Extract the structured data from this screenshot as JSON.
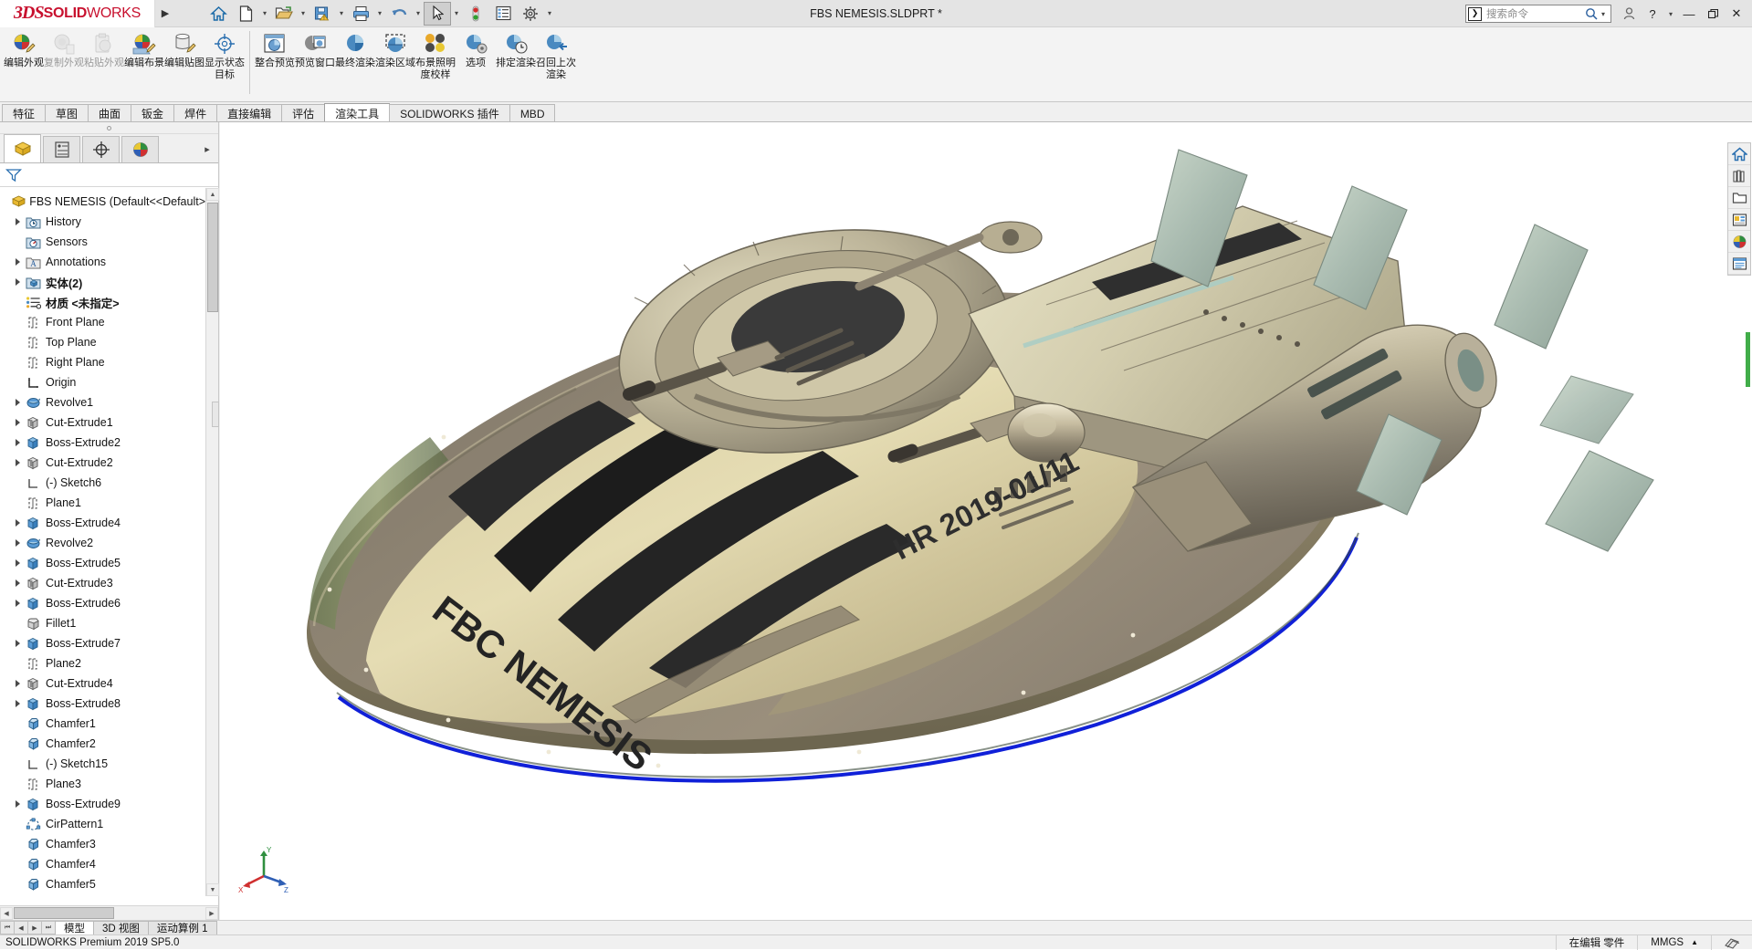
{
  "app": {
    "brand_ds": "3DS",
    "brand_solid": "SOLID",
    "brand_works": "WORKS",
    "title": "FBS NEMESIS.SLDPRT *",
    "accent_red": "#c8102e",
    "accent_blue": "#1e6fbf"
  },
  "titlebar": {
    "quick_access": [
      {
        "name": "home-icon",
        "label": "主页"
      },
      {
        "name": "new-document-icon",
        "label": "新建"
      },
      {
        "name": "open-document-icon",
        "label": "打开"
      },
      {
        "name": "save-icon",
        "label": "保存"
      },
      {
        "name": "print-icon",
        "label": "打印"
      },
      {
        "name": "undo-icon",
        "label": "撤销"
      },
      {
        "name": "select-cursor-icon",
        "label": "选择"
      },
      {
        "name": "rebuild-icon",
        "label": "重建模型"
      },
      {
        "name": "options-list-icon",
        "label": "文件属性"
      },
      {
        "name": "settings-gear-icon",
        "label": "选项"
      }
    ],
    "search_placeholder": "搜索命令",
    "search_value": "",
    "window_buttons": [
      {
        "name": "user-account-icon",
        "glyph": "○"
      },
      {
        "name": "help-icon",
        "glyph": "?"
      },
      {
        "name": "help-dropdown-icon",
        "glyph": "▾"
      },
      {
        "name": "minimize-button",
        "glyph": "—"
      },
      {
        "name": "restore-button",
        "glyph": "❐"
      },
      {
        "name": "close-button",
        "glyph": "✕"
      }
    ]
  },
  "ribbon": {
    "groups": [
      {
        "items": [
          {
            "name": "edit-appearance-button",
            "label": "编辑外观",
            "icon": "appearance-ball-pencil",
            "disabled": false
          },
          {
            "name": "copy-appearance-button",
            "label": "复制外观",
            "icon": "appearance-ball-copy",
            "disabled": true
          },
          {
            "name": "paste-appearance-button",
            "label": "粘贴外观",
            "icon": "appearance-ball-paste",
            "disabled": true
          },
          {
            "name": "edit-scene-button",
            "label": "编辑布景",
            "icon": "scene-pencil",
            "disabled": false
          },
          {
            "name": "edit-decal-button",
            "label": "编辑贴图",
            "icon": "decal-pencil",
            "disabled": false
          },
          {
            "name": "display-state-target-button",
            "label": "显示状态目标",
            "icon": "target-crosshair",
            "disabled": false
          }
        ]
      },
      {
        "items": [
          {
            "name": "integrated-preview-button",
            "label": "整合预览",
            "icon": "preview-window",
            "disabled": false
          },
          {
            "name": "preview-window-button",
            "label": "预览窗口",
            "icon": "preview-pane",
            "disabled": false
          },
          {
            "name": "final-render-button",
            "label": "最终渲染",
            "icon": "render-ball",
            "disabled": false
          },
          {
            "name": "render-region-button",
            "label": "渲染区域",
            "icon": "render-region",
            "disabled": false
          },
          {
            "name": "scene-illumination-proof-button",
            "label": "布景照明度校样",
            "icon": "illumination-proof",
            "disabled": false
          },
          {
            "name": "options-button",
            "label": "选项",
            "icon": "options-ball-gear",
            "disabled": false
          },
          {
            "name": "schedule-render-button",
            "label": "排定渲染",
            "icon": "schedule-clock",
            "disabled": false
          },
          {
            "name": "recall-last-render-button",
            "label": "召回上次渲染",
            "icon": "recall-render",
            "disabled": false
          }
        ]
      }
    ]
  },
  "command_tabs": {
    "items": [
      {
        "name": "tab-features",
        "label": "特征",
        "active": false
      },
      {
        "name": "tab-sketch",
        "label": "草图",
        "active": false
      },
      {
        "name": "tab-surfaces",
        "label": "曲面",
        "active": false
      },
      {
        "name": "tab-sheetmetal",
        "label": "钣金",
        "active": false
      },
      {
        "name": "tab-weldments",
        "label": "焊件",
        "active": false
      },
      {
        "name": "tab-direct-editing",
        "label": "直接编辑",
        "active": false
      },
      {
        "name": "tab-evaluate",
        "label": "评估",
        "active": false
      },
      {
        "name": "tab-render-tools",
        "label": "渲染工具",
        "active": true
      },
      {
        "name": "tab-solidworks-addins",
        "label": "SOLIDWORKS 插件",
        "active": false
      },
      {
        "name": "tab-mbd",
        "label": "MBD",
        "active": false
      }
    ]
  },
  "feature_manager": {
    "panel_tabs": [
      {
        "name": "feature-manager-tab",
        "icon": "yellow-block-icon",
        "active": true
      },
      {
        "name": "property-manager-tab",
        "icon": "property-page-icon",
        "active": false
      },
      {
        "name": "configuration-manager-tab",
        "icon": "config-target-icon",
        "active": false
      },
      {
        "name": "display-manager-tab",
        "icon": "appearance-ball-icon",
        "active": false
      }
    ],
    "filter_placeholder": "",
    "filter_icon": "funnel-filter-icon",
    "expand_arrow": "chevron-right-icon",
    "root": {
      "name": "feature-tree-root",
      "label": "FBS NEMESIS  (Default<<Default>",
      "icon": "part-icon"
    },
    "items": [
      {
        "label": "History",
        "icon": "history-icon",
        "expand": true,
        "indent": 1,
        "bold": false
      },
      {
        "label": "Sensors",
        "icon": "sensors-icon",
        "expand": false,
        "indent": 1,
        "bold": false
      },
      {
        "label": "Annotations",
        "icon": "annotations-icon",
        "expand": true,
        "indent": 1,
        "bold": false
      },
      {
        "label": "实体(2)",
        "icon": "solid-bodies-icon",
        "expand": true,
        "indent": 1,
        "bold": true
      },
      {
        "label": "材质 <未指定>",
        "icon": "material-icon",
        "expand": false,
        "indent": 1,
        "bold": true
      },
      {
        "label": "Front Plane",
        "icon": "plane-icon",
        "expand": false,
        "indent": 1,
        "bold": false
      },
      {
        "label": "Top Plane",
        "icon": "plane-icon",
        "expand": false,
        "indent": 1,
        "bold": false
      },
      {
        "label": "Right Plane",
        "icon": "plane-icon",
        "expand": false,
        "indent": 1,
        "bold": false
      },
      {
        "label": "Origin",
        "icon": "origin-icon",
        "expand": false,
        "indent": 1,
        "bold": false
      },
      {
        "label": "Revolve1",
        "icon": "revolve-icon",
        "expand": true,
        "indent": 1,
        "bold": false
      },
      {
        "label": "Cut-Extrude1",
        "icon": "cut-extrude-icon",
        "expand": true,
        "indent": 1,
        "bold": false
      },
      {
        "label": "Boss-Extrude2",
        "icon": "boss-extrude-icon",
        "expand": true,
        "indent": 1,
        "bold": false
      },
      {
        "label": "Cut-Extrude2",
        "icon": "cut-extrude-icon",
        "expand": true,
        "indent": 1,
        "bold": false
      },
      {
        "label": "(-) Sketch6",
        "icon": "sketch-icon",
        "expand": false,
        "indent": 1,
        "bold": false
      },
      {
        "label": "Plane1",
        "icon": "plane-icon",
        "expand": false,
        "indent": 1,
        "bold": false
      },
      {
        "label": "Boss-Extrude4",
        "icon": "boss-extrude-icon",
        "expand": true,
        "indent": 1,
        "bold": false
      },
      {
        "label": "Revolve2",
        "icon": "revolve-icon",
        "expand": true,
        "indent": 1,
        "bold": false
      },
      {
        "label": "Boss-Extrude5",
        "icon": "boss-extrude-icon",
        "expand": true,
        "indent": 1,
        "bold": false
      },
      {
        "label": "Cut-Extrude3",
        "icon": "cut-extrude-icon",
        "expand": true,
        "indent": 1,
        "bold": false
      },
      {
        "label": "Boss-Extrude6",
        "icon": "boss-extrude-icon",
        "expand": true,
        "indent": 1,
        "bold": false
      },
      {
        "label": "Fillet1",
        "icon": "fillet-icon",
        "expand": false,
        "indent": 1,
        "bold": false
      },
      {
        "label": "Boss-Extrude7",
        "icon": "boss-extrude-icon",
        "expand": true,
        "indent": 1,
        "bold": false
      },
      {
        "label": "Plane2",
        "icon": "plane-icon",
        "expand": false,
        "indent": 1,
        "bold": false
      },
      {
        "label": "Cut-Extrude4",
        "icon": "cut-extrude-icon",
        "expand": true,
        "indent": 1,
        "bold": false
      },
      {
        "label": "Boss-Extrude8",
        "icon": "boss-extrude-icon",
        "expand": true,
        "indent": 1,
        "bold": false
      },
      {
        "label": "Chamfer1",
        "icon": "chamfer-icon",
        "expand": false,
        "indent": 1,
        "bold": false
      },
      {
        "label": "Chamfer2",
        "icon": "chamfer-icon",
        "expand": false,
        "indent": 1,
        "bold": false
      },
      {
        "label": "(-) Sketch15",
        "icon": "sketch-icon",
        "expand": false,
        "indent": 1,
        "bold": false
      },
      {
        "label": "Plane3",
        "icon": "plane-icon",
        "expand": false,
        "indent": 1,
        "bold": false
      },
      {
        "label": "Boss-Extrude9",
        "icon": "boss-extrude-icon",
        "expand": true,
        "indent": 1,
        "bold": false
      },
      {
        "label": "CirPattern1",
        "icon": "circular-pattern-icon",
        "expand": false,
        "indent": 1,
        "bold": false
      },
      {
        "label": "Chamfer3",
        "icon": "chamfer-icon",
        "expand": false,
        "indent": 1,
        "bold": false
      },
      {
        "label": "Chamfer4",
        "icon": "chamfer-icon",
        "expand": false,
        "indent": 1,
        "bold": false
      },
      {
        "label": "Chamfer5",
        "icon": "chamfer-icon",
        "expand": false,
        "indent": 1,
        "bold": false
      }
    ]
  },
  "viewport": {
    "heads_up": [
      {
        "name": "section-view-icon"
      },
      {
        "name": "zoom-to-fit-icon"
      },
      {
        "name": "zoom-to-area-icon"
      },
      {
        "name": "previous-view-icon"
      },
      {
        "name": "section-cut-icon"
      },
      {
        "name": "view-orientation-icon"
      },
      {
        "name": "display-style-icon"
      },
      {
        "name": "hide-show-items-icon",
        "caret": true
      },
      {
        "name": "edit-appearance-icon",
        "caret": true
      },
      {
        "name": "apply-scene-icon",
        "caret": true
      },
      {
        "name": "view-settings-icon",
        "caret": true
      },
      {
        "name": "appearance-ball-icon"
      },
      {
        "name": "scene-backdrop-icon",
        "caret": true
      },
      {
        "name": "display-monitor-icon",
        "caret": true
      }
    ],
    "window_buttons": [
      {
        "name": "restore-doc-button",
        "glyph": "◰"
      },
      {
        "name": "minimize-doc-button",
        "glyph": "–"
      },
      {
        "name": "maximize-doc-button",
        "glyph": "□"
      },
      {
        "name": "close-doc-button",
        "glyph": "✕"
      }
    ],
    "right_toolbar": [
      {
        "name": "task-pane-home-icon"
      },
      {
        "name": "design-library-icon"
      },
      {
        "name": "file-explorer-icon"
      },
      {
        "name": "view-palette-icon"
      },
      {
        "name": "appearances-scenes-icon"
      },
      {
        "name": "custom-properties-icon"
      }
    ],
    "model": {
      "name": "FBS NEMESIS starship model",
      "hull_text_left": "FBC NEMESIS",
      "hull_text_right": "HR 2019-01/11",
      "triad_axes": [
        "X",
        "Y",
        "Z"
      ]
    }
  },
  "bottom": {
    "nav_buttons": [
      {
        "name": "first-config-button",
        "glyph": "⏮"
      },
      {
        "name": "prev-config-button",
        "glyph": "◀"
      },
      {
        "name": "next-config-button",
        "glyph": "▶"
      },
      {
        "name": "last-config-button",
        "glyph": "⏭"
      }
    ],
    "tabs": [
      {
        "name": "tab-model",
        "label": "模型",
        "active": true
      },
      {
        "name": "tab-3d-views",
        "label": "3D 视图",
        "active": false
      },
      {
        "name": "tab-motion-study",
        "label": "运动算例 1",
        "active": false
      }
    ]
  },
  "status_bar": {
    "version": "SOLIDWORKS Premium 2019 SP5.0",
    "edit_state": "在编辑 零件",
    "units": "MMGS",
    "units_caret": "▴",
    "overlay_icon": "overlay-icon"
  }
}
